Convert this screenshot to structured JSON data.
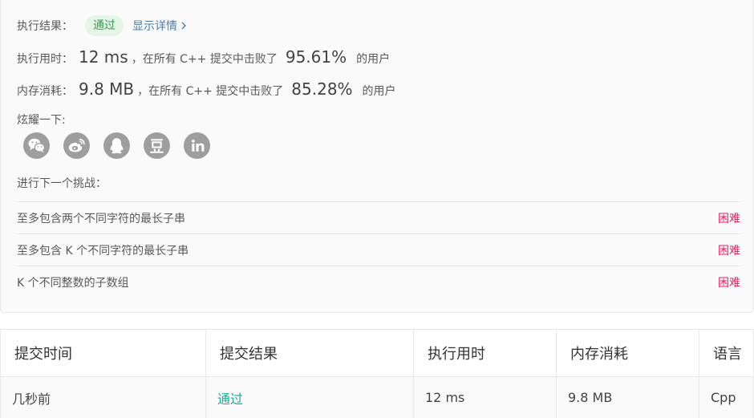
{
  "result": {
    "label": "执行结果：",
    "status_badge": "通过",
    "details_link": "显示详情"
  },
  "runtime": {
    "label": "执行用时：",
    "value": "12 ms",
    "middle_text": "，在所有 C++ 提交中击败了",
    "percent": "95.61%",
    "suffix": "的用户"
  },
  "memory": {
    "label": "内存消耗：",
    "value": "9.8 MB",
    "middle_text": "，在所有 C++ 提交中击败了",
    "percent": "85.28%",
    "suffix": "的用户"
  },
  "share": {
    "label": "炫耀一下:",
    "icons": [
      "wechat-icon",
      "weibo-icon",
      "qq-icon",
      "douban-icon",
      "linkedin-icon"
    ]
  },
  "next_challenge": {
    "label": "进行下一个挑战：",
    "items": [
      {
        "title": "至多包含两个不同字符的最长子串",
        "difficulty": "困难"
      },
      {
        "title": "至多包含 K 个不同字符的最长子串",
        "difficulty": "困难"
      },
      {
        "title": "K 个不同整数的子数组",
        "difficulty": "困难"
      }
    ]
  },
  "table": {
    "headers": [
      "提交时间",
      "提交结果",
      "执行用时",
      "内存消耗",
      "语言"
    ],
    "rows": [
      [
        "几秒前",
        "通过",
        "12 ms",
        "9.8 MB",
        "Cpp"
      ]
    ]
  },
  "colors": {
    "pass_green": "#3a9a55",
    "badge_bg": "#e4f4e7",
    "link_blue": "#4b7ea8",
    "difficulty_hard": "#e91e63",
    "share_icon_bg": "#9e9e9e",
    "table_pass_link": "#26a69a"
  }
}
